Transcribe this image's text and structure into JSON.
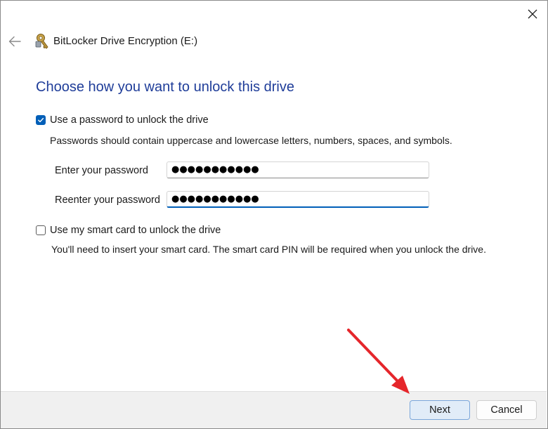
{
  "window": {
    "title": "BitLocker Drive Encryption (E:)"
  },
  "icons": {
    "close": "close-icon",
    "back": "back-arrow-icon",
    "app": "bitlocker-key-icon",
    "checkmark": "checkmark-icon",
    "annotation": "red-arrow-annotation"
  },
  "main": {
    "heading": "Choose how you want to unlock this drive",
    "password_option": {
      "label": "Use a password to unlock the drive",
      "checked": true,
      "description": "Passwords should contain uppercase and lowercase letters, numbers, spaces, and symbols.",
      "enter_label": "Enter your password",
      "enter_value": "●●●●●●●●●●●",
      "reenter_label": "Reenter your password",
      "reenter_value": "●●●●●●●●●●●"
    },
    "smartcard_option": {
      "label": "Use my smart card to unlock the drive",
      "checked": false,
      "description": "You'll need to insert your smart card. The smart card PIN will be required when you unlock the drive."
    }
  },
  "footer": {
    "next_label": "Next",
    "cancel_label": "Cancel"
  },
  "colors": {
    "heading": "#1f3d99",
    "accent": "#005fb8",
    "annotation_arrow": "#e5262b"
  }
}
